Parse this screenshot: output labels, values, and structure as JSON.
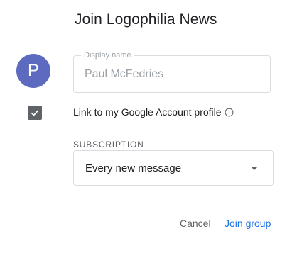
{
  "dialog": {
    "title": "Join Logophilia News",
    "avatar_letter": "P",
    "avatar_color": "#5c6bc0",
    "display_name": {
      "label": "Display name",
      "value": "Paul McFedries"
    },
    "link_profile": {
      "checked": true,
      "label": "Link to my Google Account profile",
      "icon": "info-icon"
    },
    "subscription": {
      "label": "SUBSCRIPTION",
      "selected": "Every new message"
    },
    "actions": {
      "cancel_label": "Cancel",
      "join_label": "Join group",
      "accent_color": "#1a73e8"
    }
  }
}
